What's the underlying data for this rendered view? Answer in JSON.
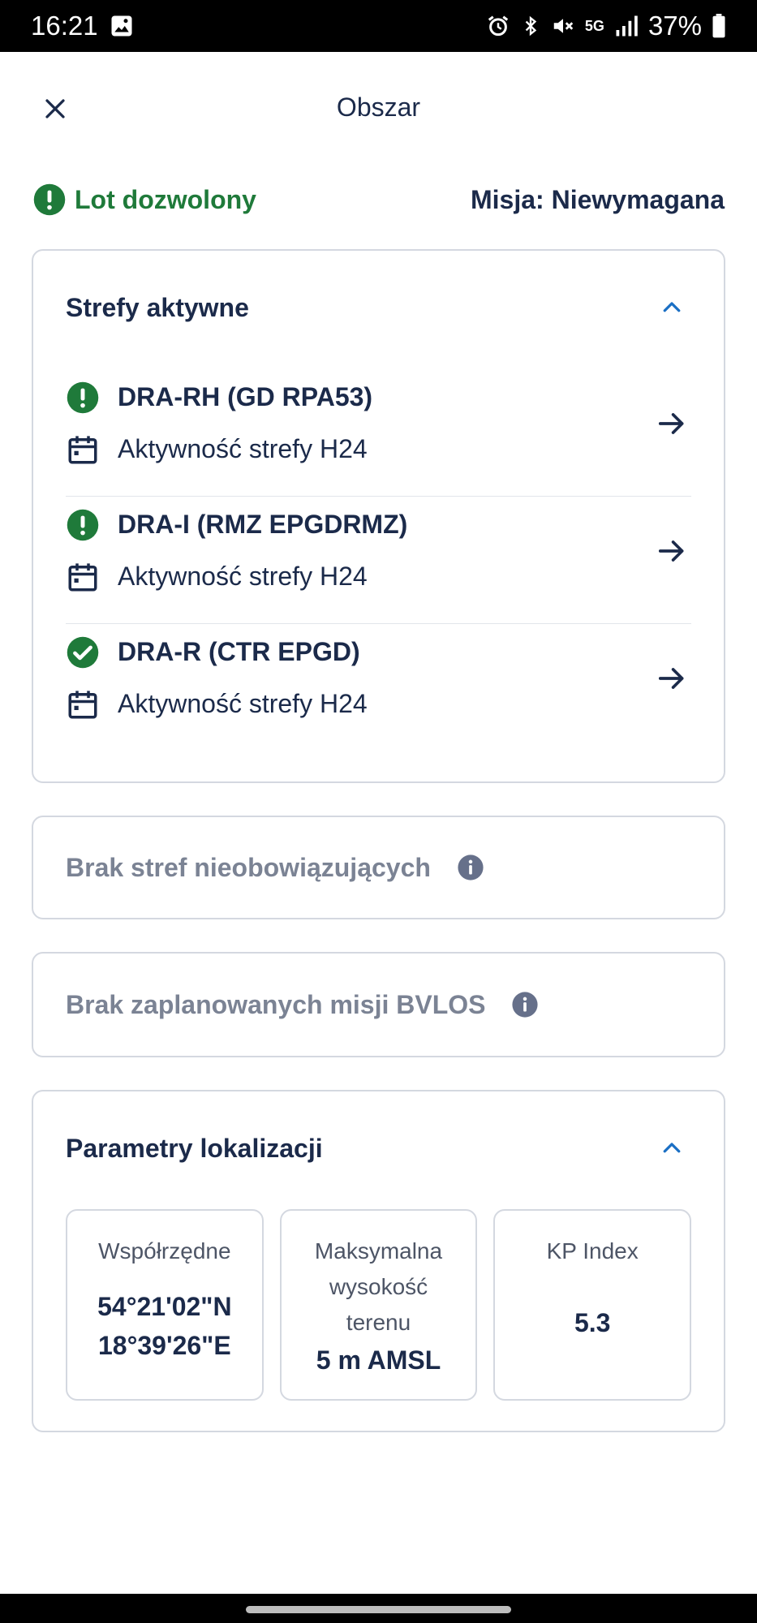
{
  "status_bar": {
    "time": "16:21",
    "network": "5G",
    "battery": "37%",
    "icons": [
      "image-icon",
      "alarm-icon",
      "bluetooth-icon",
      "mute-icon",
      "signal-icon",
      "battery-icon"
    ]
  },
  "header": {
    "title": "Obszar",
    "close_icon": "close-icon"
  },
  "flight": {
    "status": "Lot dozwolony",
    "mission": "Misja: Niewymagana"
  },
  "active_zones": {
    "title": "Strefy aktywne",
    "items": [
      {
        "name": "DRA-RH (GD RPA53)",
        "activity": "Aktywność strefy H24",
        "status_icon": "exclamation-icon"
      },
      {
        "name": "DRA-I (RMZ EPGDRMZ)",
        "activity": "Aktywność strefy H24",
        "status_icon": "exclamation-icon"
      },
      {
        "name": "DRA-R (CTR EPGD)",
        "activity": "Aktywność strefy H24",
        "status_icon": "check-icon"
      }
    ]
  },
  "no_inactive_zones": {
    "text": "Brak stref nieobowiązujących"
  },
  "no_bvlos": {
    "text": "Brak zaplanowanych misji BVLOS"
  },
  "location_params": {
    "title": "Parametry lokalizacji",
    "coords": {
      "label": "Współrzędne",
      "lat": "54°21'02\"N",
      "lon": "18°39'26\"E"
    },
    "elevation": {
      "label_line1": "Maksymalna",
      "label_line2": "wysokość",
      "label_line3": "terenu",
      "value": "5 m AMSL"
    },
    "kp": {
      "label": "KP Index",
      "value": "5.3"
    }
  },
  "colors": {
    "success": "#1f7a3a",
    "text_dark": "#1b2a4a",
    "muted": "#7b8394",
    "accent_blue": "#1a6fc4",
    "border": "#d4d8e0"
  }
}
